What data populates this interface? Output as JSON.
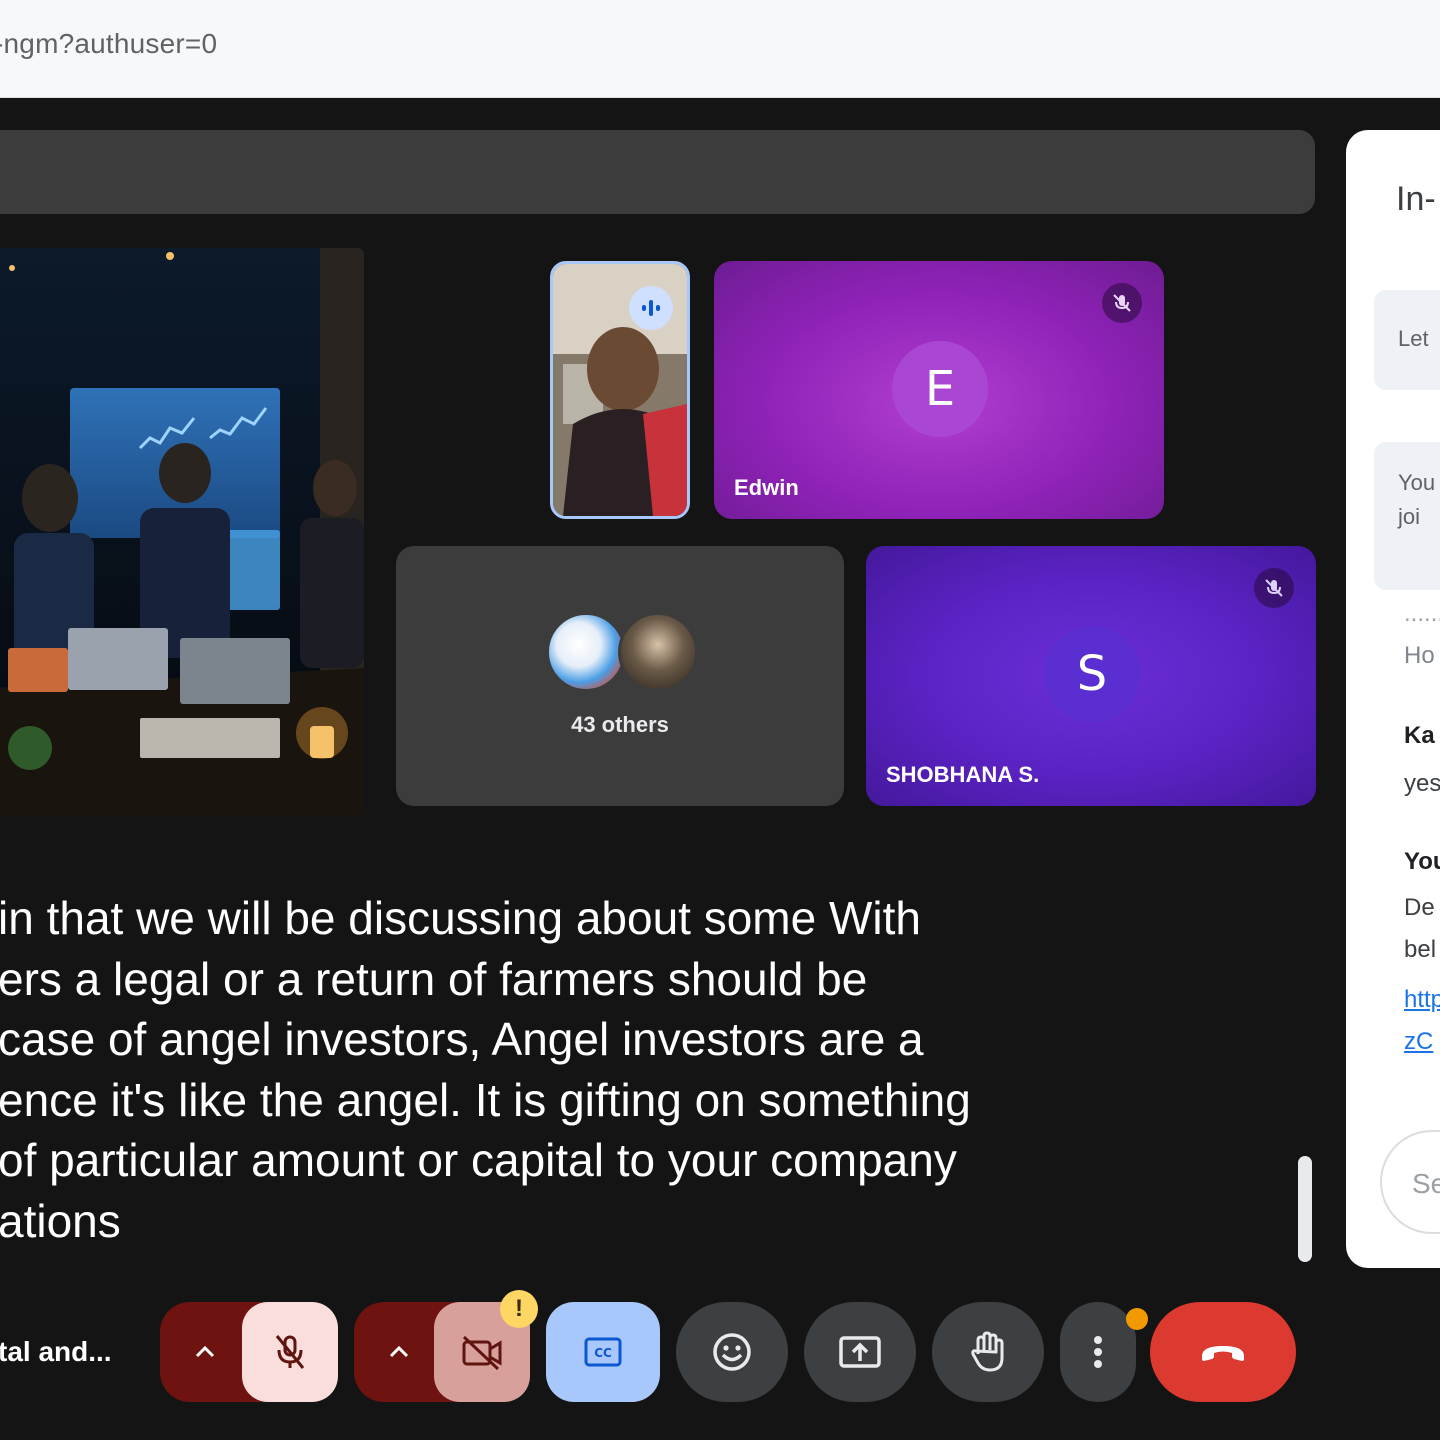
{
  "browser": {
    "url_fragment": "-ngm?authuser=0"
  },
  "participants": {
    "self": {
      "speaking": true
    },
    "edwin": {
      "initial": "E",
      "name": "Edwin",
      "muted": true
    },
    "others": {
      "label": "43 others"
    },
    "shobhana": {
      "initial": "S",
      "name": "SHOBHANA S.",
      "muted": true
    }
  },
  "captions": {
    "lines": [
      "in that we will be discussing about some With",
      "ers a legal or a return of farmers should be",
      "case of angel investors, Angel investors are a",
      "ence it's like the angel. It is gifting on something",
      "of particular amount or capital to your company",
      "ations"
    ]
  },
  "side_panel": {
    "title": "In-",
    "card1_text": "Let",
    "card2_line1": "You",
    "card2_line2": "joi",
    "dots": "......",
    "msg_how": "Ho",
    "sender1": "Ka",
    "msg_yes": "yes",
    "sender2": "You",
    "msg_de": "De",
    "msg_bel": "bel",
    "link1": "http",
    "link2": "zC",
    "input_placeholder": "Se"
  },
  "controls": {
    "meeting_title": "tal and...",
    "mic": "muted",
    "camera": "off",
    "camera_warning": "!",
    "captions": "on"
  },
  "colors": {
    "meet_bg": "#141414",
    "edwin_tile": "#9b2fc4",
    "shobhana_tile": "#5a22c2",
    "end_call": "#dc3a30",
    "captions_on": "#a8c7fa",
    "muted_group": "#6e1310"
  }
}
